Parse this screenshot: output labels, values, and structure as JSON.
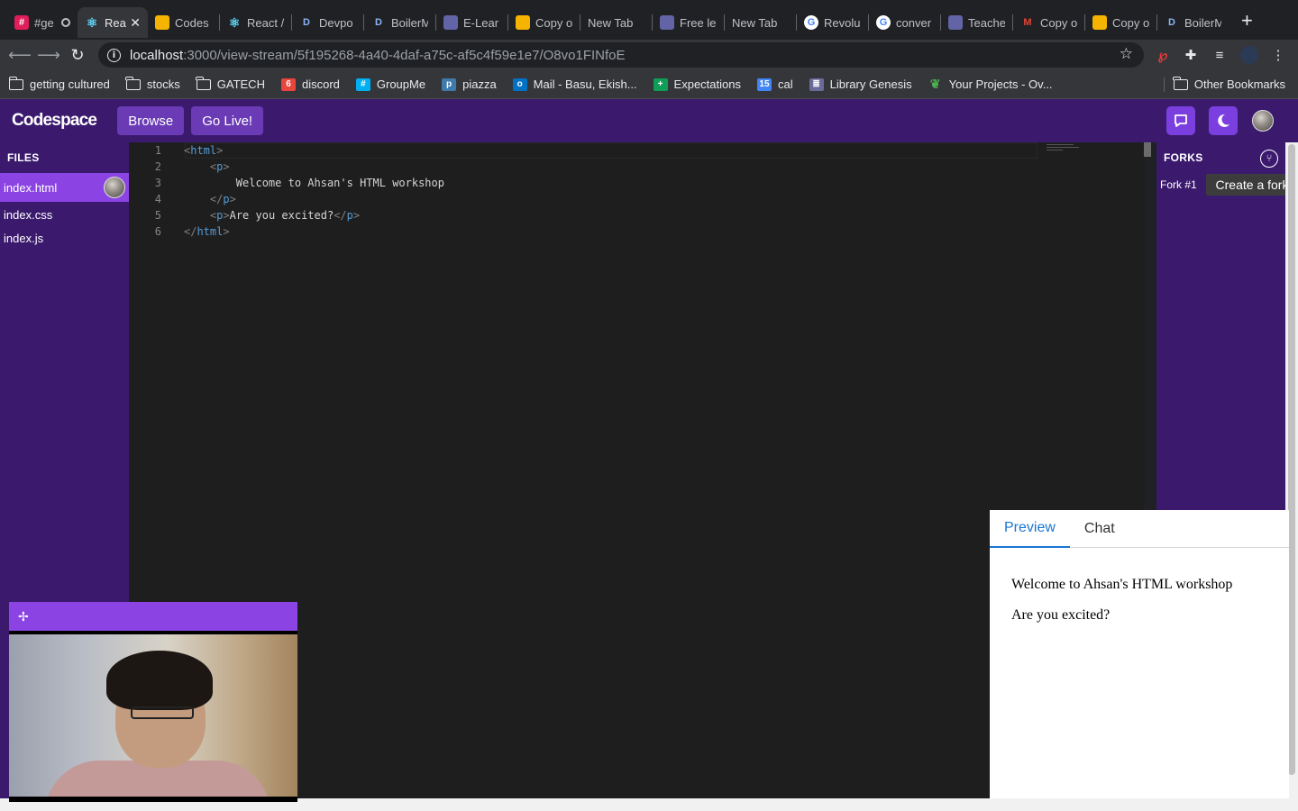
{
  "browser": {
    "tabs": [
      {
        "label": "#ge",
        "icon": "slack-icon",
        "color": "#e01e5a"
      },
      {
        "label": "Rea",
        "icon": "react-icon",
        "color": "#61dafb",
        "active": true
      },
      {
        "label": "Codes",
        "icon": "slides-icon",
        "color": "#f4b400"
      },
      {
        "label": "React /",
        "icon": "react-icon",
        "color": "#61dafb"
      },
      {
        "label": "Devpo",
        "icon": "d-icon",
        "color": "#1a73e8"
      },
      {
        "label": "BoilerM",
        "icon": "d-icon",
        "color": "#1a73e8"
      },
      {
        "label": "E-Lear",
        "icon": "teams-icon",
        "color": "#6264a7"
      },
      {
        "label": "Copy o",
        "icon": "slides-icon",
        "color": "#f4b400"
      },
      {
        "label": "New Tab",
        "icon": "",
        "color": ""
      },
      {
        "label": "Free le",
        "icon": "teams-icon",
        "color": "#6264a7"
      },
      {
        "label": "New Tab",
        "icon": "",
        "color": ""
      },
      {
        "label": "Revolu",
        "icon": "google-icon",
        "color": "#ffffff"
      },
      {
        "label": "conver",
        "icon": "google-icon",
        "color": "#ffffff"
      },
      {
        "label": "Teache",
        "icon": "teams-icon",
        "color": "#6264a7"
      },
      {
        "label": "Copy o",
        "icon": "gmail-icon",
        "color": "#ea4335"
      },
      {
        "label": "Copy o",
        "icon": "slides-icon",
        "color": "#f4b400"
      },
      {
        "label": "BoilerM",
        "icon": "d-icon",
        "color": "#1a73e8"
      }
    ],
    "url_host": "localhost",
    "url_path": ":3000/view-stream/5f195268-4a40-4daf-a75c-af5c4f59e1e7/O8vo1FINfoE",
    "bookmarks": [
      {
        "label": "getting cultured",
        "type": "folder"
      },
      {
        "label": "stocks",
        "type": "folder"
      },
      {
        "label": "GATECH",
        "type": "folder"
      },
      {
        "label": "discord",
        "type": "link",
        "color": "#e8453c"
      },
      {
        "label": "GroupMe",
        "type": "link",
        "color": "#00aff0"
      },
      {
        "label": "piazza",
        "type": "link",
        "color": "#3e7aab"
      },
      {
        "label": "Mail - Basu, Ekish...",
        "type": "link",
        "color": "#0072c6"
      },
      {
        "label": "Expectations",
        "type": "link",
        "color": "#0f9d58"
      },
      {
        "label": "cal",
        "type": "link",
        "color": "#4285f4"
      },
      {
        "label": "Library Genesis",
        "type": "link",
        "color": "#6b6b9a"
      },
      {
        "label": "Your Projects - Ov...",
        "type": "link",
        "color": "#2e7d32"
      }
    ],
    "other_bookmarks": "Other Bookmarks"
  },
  "app": {
    "logo": "Codespace",
    "browse_label": "Browse",
    "golive_label": "Go Live!",
    "accent": "#3b1a6e",
    "button_color": "#6a3bb4"
  },
  "files": {
    "title": "FILES",
    "items": [
      "index.html",
      "index.css",
      "index.js"
    ]
  },
  "editor": {
    "lines": [
      {
        "num": "1"
      },
      {
        "num": "2"
      },
      {
        "num": "3",
        "text": "Welcome to Ahsan's HTML workshop"
      },
      {
        "num": "4"
      },
      {
        "num": "5",
        "text": "Are you excited?"
      },
      {
        "num": "6"
      }
    ],
    "tag_html": "html",
    "tag_p": "p"
  },
  "forks": {
    "title": "FORKS",
    "items": [
      "Fork #1"
    ],
    "tooltip": "Create a fork"
  },
  "preview": {
    "tabs": [
      "Preview",
      "Chat"
    ],
    "lines": [
      "Welcome to Ahsan's HTML workshop",
      "Are you excited?"
    ]
  }
}
